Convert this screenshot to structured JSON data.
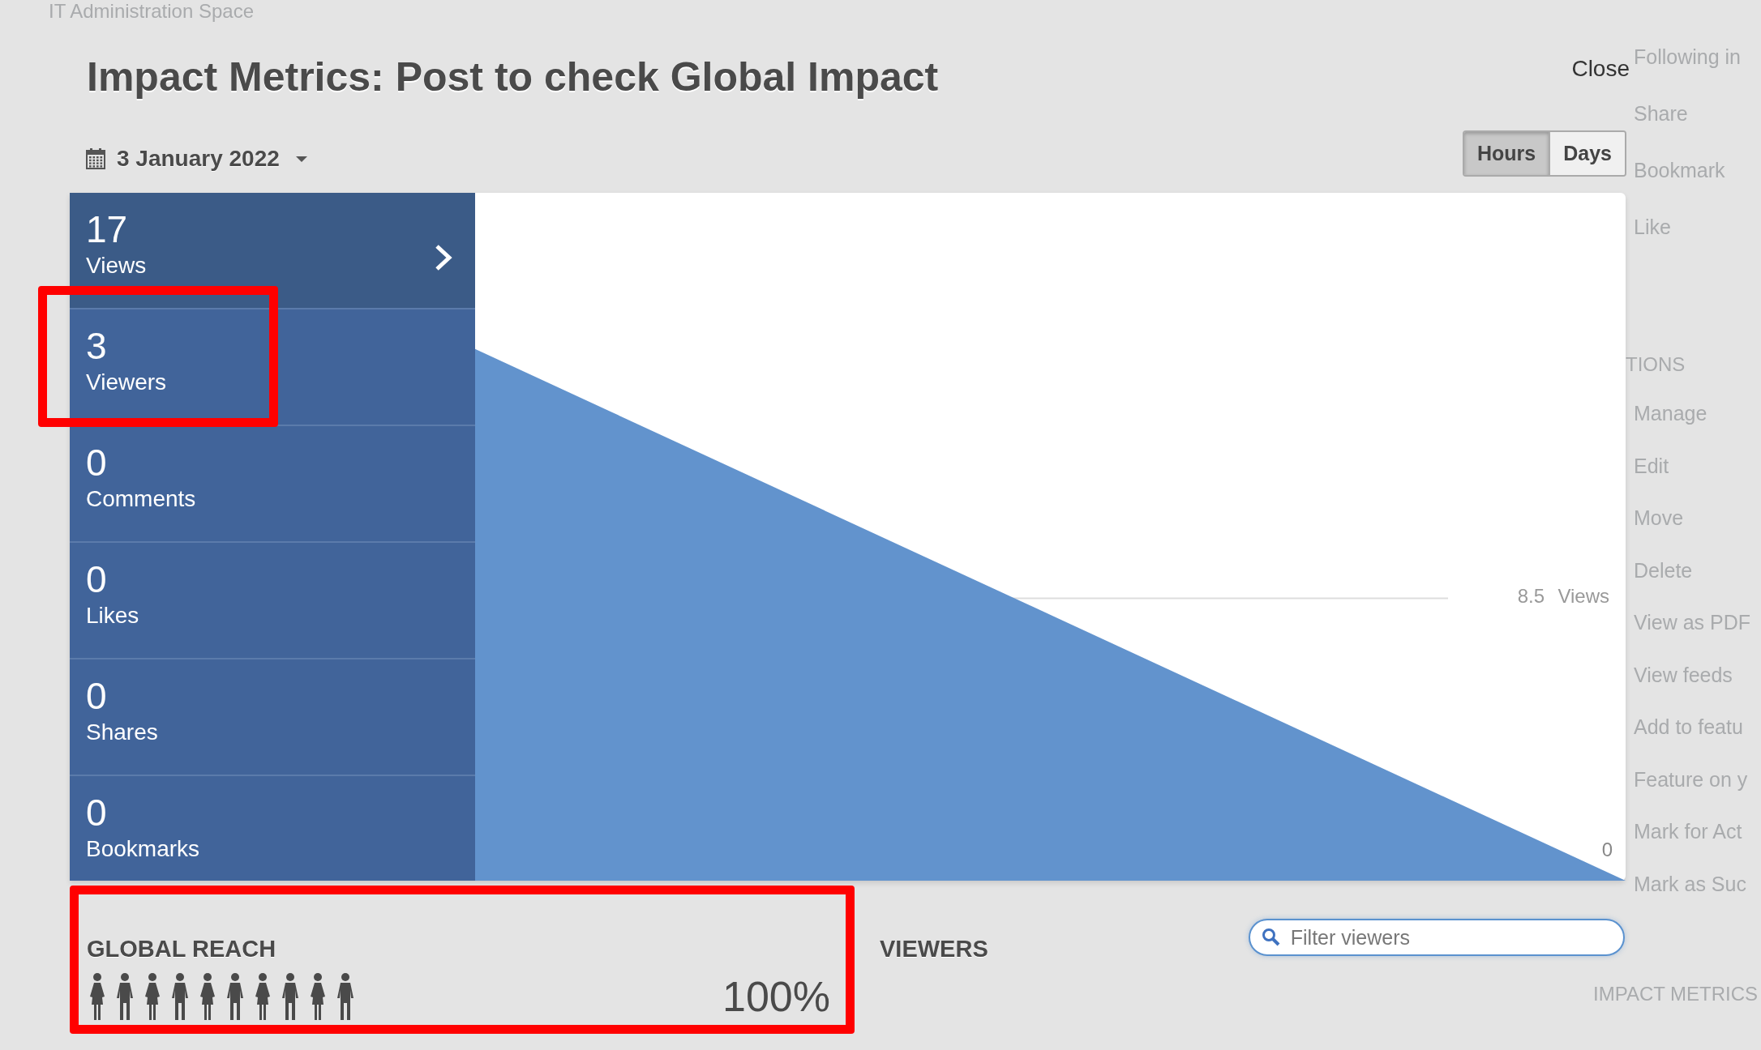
{
  "background": {
    "space_title": "IT Administration Space",
    "top_items": [
      "Following in",
      "Share",
      "Bookmark",
      "Like"
    ],
    "actions_heading": "TIONS",
    "action_items": [
      "Manage",
      "Edit",
      "Move",
      "Delete",
      "View as PDF",
      "View feeds",
      "Add to featu",
      "Feature on y",
      "Mark for Act",
      "Mark as Suc"
    ],
    "footer_heading": "IMPACT METRICS"
  },
  "dialog": {
    "title": "Impact Metrics: Post to check Global Impact",
    "close": "Close",
    "date": "3 January 2022",
    "ranges": [
      {
        "label": "Hours",
        "selected": true
      },
      {
        "label": "Days",
        "selected": false
      }
    ],
    "stats": [
      {
        "value": "17",
        "label": "Views",
        "selected": true
      },
      {
        "value": "3",
        "label": "Viewers",
        "selected": false
      },
      {
        "value": "0",
        "label": "Comments",
        "selected": false
      },
      {
        "value": "0",
        "label": "Likes",
        "selected": false
      },
      {
        "value": "0",
        "label": "Shares",
        "selected": false
      },
      {
        "value": "0",
        "label": "Bookmarks",
        "selected": false
      }
    ],
    "chart": {
      "grid_value": "8.5",
      "unit": "Views",
      "baseline_value": "0"
    },
    "global_reach": {
      "title": "GLOBAL REACH",
      "percent": "100%"
    },
    "viewers": {
      "title": "VIEWERS",
      "filter": {
        "placeholder": "Filter viewers"
      }
    }
  }
}
